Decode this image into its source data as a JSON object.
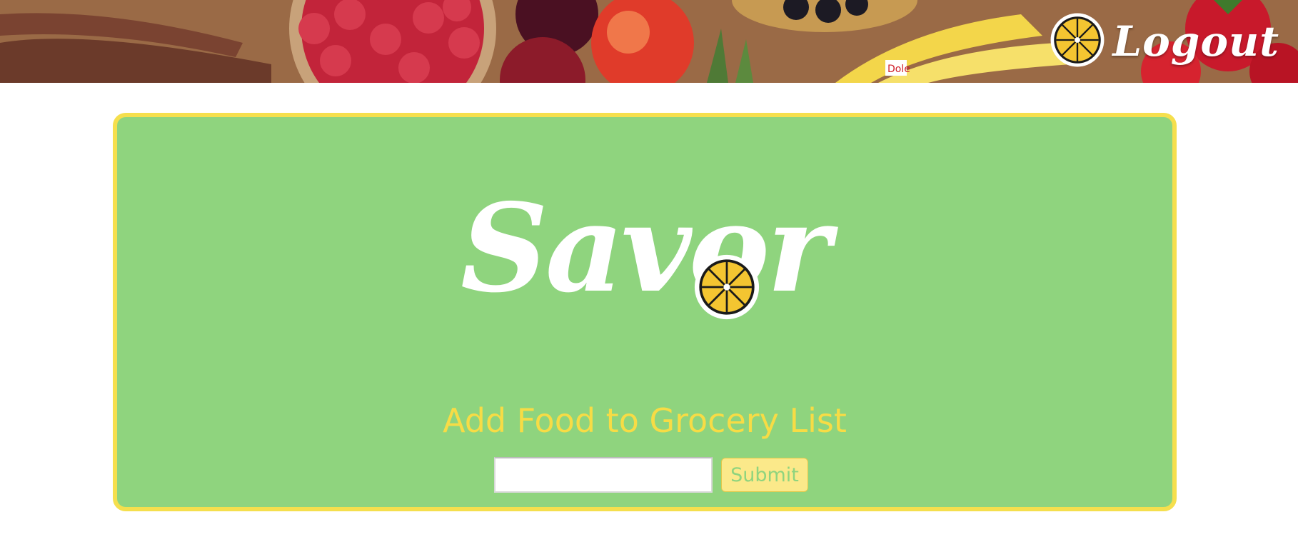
{
  "header": {
    "logout_label": "Logout"
  },
  "brand": {
    "logo_text": "Savor"
  },
  "grocery_form": {
    "heading": "Add Food to Grocery List",
    "input_value": "",
    "input_placeholder": "",
    "submit_label": "Submit"
  },
  "colors": {
    "card_background": "#8fd47e",
    "card_border": "#f5df4d",
    "heading": "#f7dc45",
    "button_background": "#fbe98a"
  },
  "icons": [
    "lemon-slice-icon"
  ]
}
